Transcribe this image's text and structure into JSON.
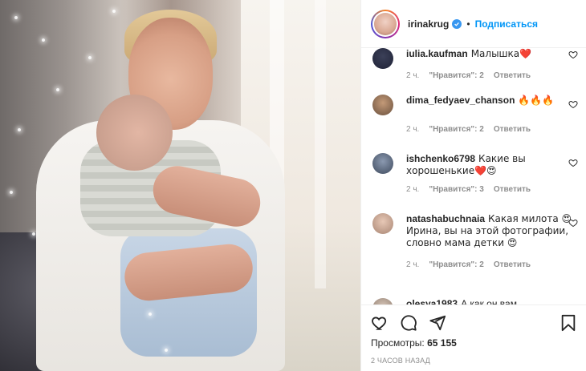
{
  "header": {
    "username": "irinakrug",
    "follow_label": "Подписаться",
    "separator": "•"
  },
  "comments": [
    {
      "user": "iulia.kaufman",
      "text": "Малышка❤️",
      "age": "2 ч.",
      "likes": "\"Нравится\": 2",
      "reply": "Ответить"
    },
    {
      "user": "dima_fedyaev_chanson",
      "text": "🔥🔥🔥",
      "age": "2 ч.",
      "likes": "\"Нравится\": 2",
      "reply": "Ответить"
    },
    {
      "user": "ishchenko6798",
      "text": "Какие вы хорошенькие❤️😍",
      "age": "2 ч.",
      "likes": "\"Нравится\": 3",
      "reply": "Ответить"
    },
    {
      "user": "natashabuchnaia",
      "text": "Какая милота 😍 Ирина, вы на этой фотографии, словно мама детки 😍",
      "age": "2 ч.",
      "likes": "\"Нравится\": 2",
      "reply": "Ответить"
    },
    {
      "user": "olesya1983",
      "text": "А как он вам",
      "age": "",
      "likes": "",
      "reply": ""
    }
  ],
  "footer": {
    "views_label": "Просмотры:",
    "views_count": "65 155",
    "timestamp": "2 ЧАСОВ НАЗАД"
  },
  "colors": {
    "follow": "#0095f6",
    "verified": "#3897f0",
    "heart": "#ed4956"
  }
}
